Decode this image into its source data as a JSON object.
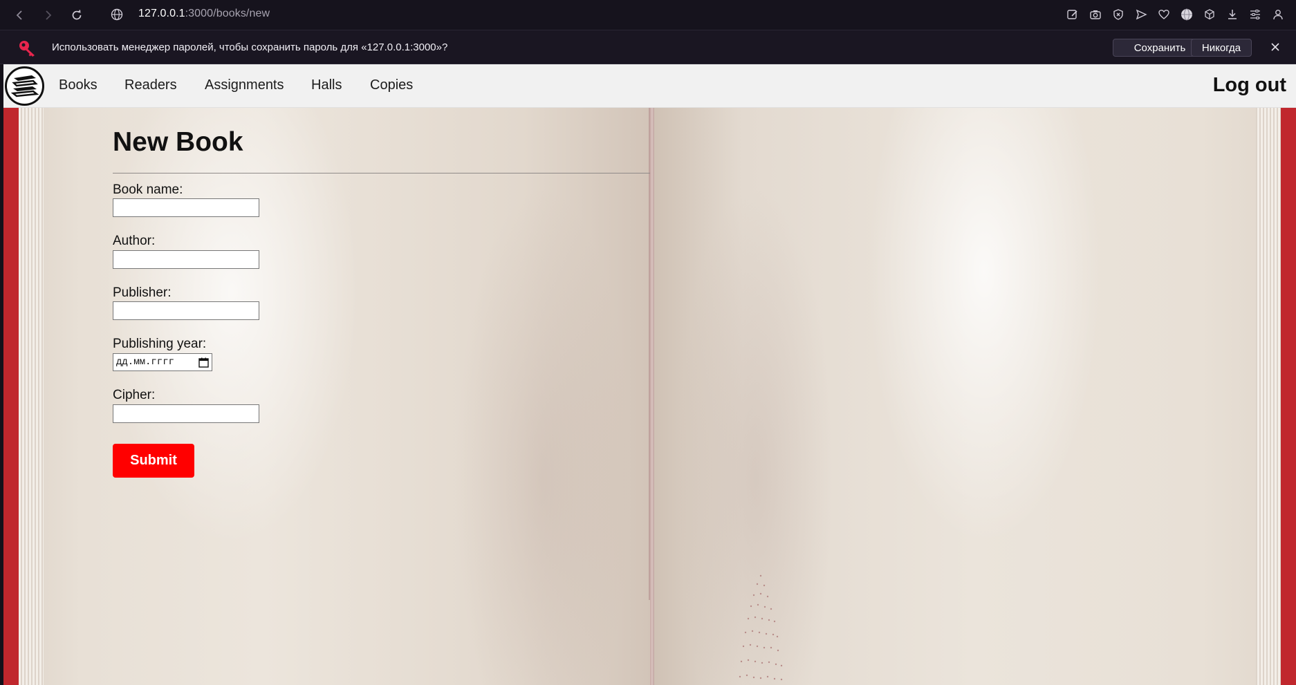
{
  "browser": {
    "url_host": "127.0.0.1",
    "url_rest": ":3000/books/new"
  },
  "password_bar": {
    "message": "Использовать менеджер паролей, чтобы сохранить пароль для «127.0.0.1:3000»?",
    "save_label": "Сохранить",
    "never_label": "Никогда"
  },
  "nav": {
    "links": [
      "Books",
      "Readers",
      "Assignments",
      "Halls",
      "Copies"
    ],
    "logout_label": "Log out"
  },
  "page": {
    "title": "New Book",
    "fields": {
      "book_name": {
        "label": "Book name:",
        "value": ""
      },
      "author": {
        "label": "Author:",
        "value": ""
      },
      "publisher": {
        "label": "Publisher:",
        "value": ""
      },
      "publishing_year": {
        "label": "Publishing year:",
        "placeholder": "дд.мм.гггг"
      },
      "cipher": {
        "label": "Cipher:",
        "value": ""
      }
    },
    "submit_label": "Submit"
  },
  "colors": {
    "accent": "#ff0000",
    "book_cover": "#c0272d",
    "navbar_bg": "#f1f1f1"
  }
}
